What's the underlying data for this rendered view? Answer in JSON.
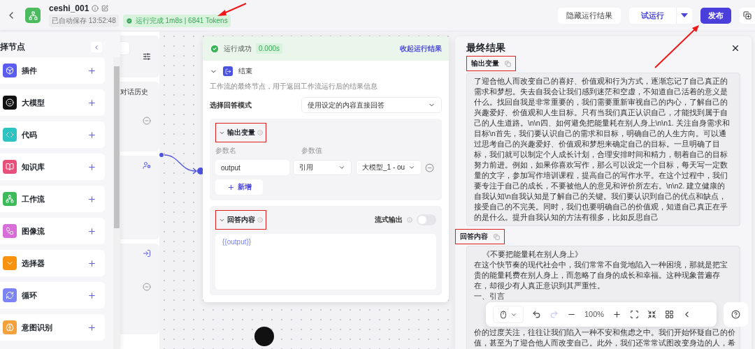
{
  "header": {
    "title": "ceshi_001",
    "autosave": "已自动保存 13:52:48",
    "run_status": "运行完成 1m8s | 6841 Tokens",
    "buttons": {
      "hide_results": "隐藏运行结果",
      "test_run": "试运行",
      "publish": "发布"
    }
  },
  "sidebar": {
    "title": "择节点",
    "items": [
      {
        "label": "插件",
        "color": "#5b5cf0"
      },
      {
        "label": "大模型",
        "color": "#111111"
      },
      {
        "label": "代码",
        "color": "#2ec4c4"
      },
      {
        "label": "知识库",
        "color": "#e8507a"
      },
      {
        "label": "工作流",
        "color": "#3dbb5a"
      },
      {
        "label": "图像流",
        "color": "#d86fd8"
      },
      {
        "label": "选择器",
        "color": "#f7930e"
      },
      {
        "label": "循环",
        "color": "#7b83f7"
      },
      {
        "label": "意图识别",
        "color": "#f4a13c"
      }
    ]
  },
  "hidden_node": {
    "label": "对话历史"
  },
  "end_node": {
    "run_status": "运行成功",
    "duration": "0.000s",
    "collapse_link": "收起运行结果",
    "title": "结束",
    "description": "工作流的最终节点，用于返回工作流运行后的结果信息",
    "mode_label": "选择回答模式",
    "mode_value": "使用设定的内容直接回答",
    "output_section": {
      "title": "输出变量",
      "highlighted": true,
      "expanded": true,
      "param_name_label": "参数名",
      "param_value_label": "参数值",
      "param_name": "output",
      "ref_type": "引用",
      "ref_value": "大模型_1 - ou",
      "add_button": "新增"
    },
    "answer_section": {
      "title": "回答内容",
      "highlighted": true,
      "expanded": true,
      "stream_label": "流式输出",
      "stream_on": false,
      "content": "{{output}}"
    }
  },
  "result_panel": {
    "title": "最终结果",
    "output": {
      "title": "输出变量",
      "highlighted": true,
      "text": "了迎合他人而改变自己的喜好、价值观和行为方式，逐渐忘记了自己真正的需求和梦想。失去自我会让我们感到迷茫和空虚，不知道自己活着的意义是什么。找回自我是非常重要的，我们需要重新审视自己的内心，了解自己的兴趣爱好、价值观和人生目标。只有当我们真正认识自己，才能找到属于自己的人生道路。\\n\\n四、如何避免把能量耗在别人身上\\n\\n1. 关注自身需求和目标\\n首先，我们要认识自己的需求和目标，明确自己的人生方向。可以通过思考自己的兴趣爱好、价值观和梦想来确定自己的目标。一旦明确了目标，我们就可以制定个人成长计划，合理安排时间和精力，朝着自己的目标努力前进。例如，如果你喜欢写作，那么可以设定一个目标，每天写一定数量的文字，参加写作培训课程，提高自己的写作水平。在这个过程中，我们要专注于自己的成长，不要被他人的意见和评价所左右。\\n\\n2. 建立健康的自我认知\\n自我认知是了解自己的关键。我们要认识到自己的优点和缺点，接受自己的不完美。同时，我们也要明确自己的价值观，知道自己真正在乎的是什么。提升自我认知的方法有很多，比如反思自己"
    },
    "answer": {
      "title": "回答内容",
      "highlighted": true,
      "lines_before": [
        "《不要把能量耗在别人身上》",
        "在这个快节奏的现代社会中，我们常常不自觉地陷入一种困境，那就是把宝贵的能量耗费在别人身上，而忽略了自身的成长和幸福。这种现象普遍存在，却很少有人真正意识到其严重性。",
        "一、引言"
      ],
      "lines_after": [
        "价的过度关注，往往让我们陷入一种不安和焦虑之中。我们开始怀疑自己的价",
        "值，甚至为了迎合他人而改变自己。此外，我们还常常试图改变身边的人，希"
      ]
    }
  },
  "toolbar": {
    "zoom": "100%",
    "redo_disabled": true
  }
}
